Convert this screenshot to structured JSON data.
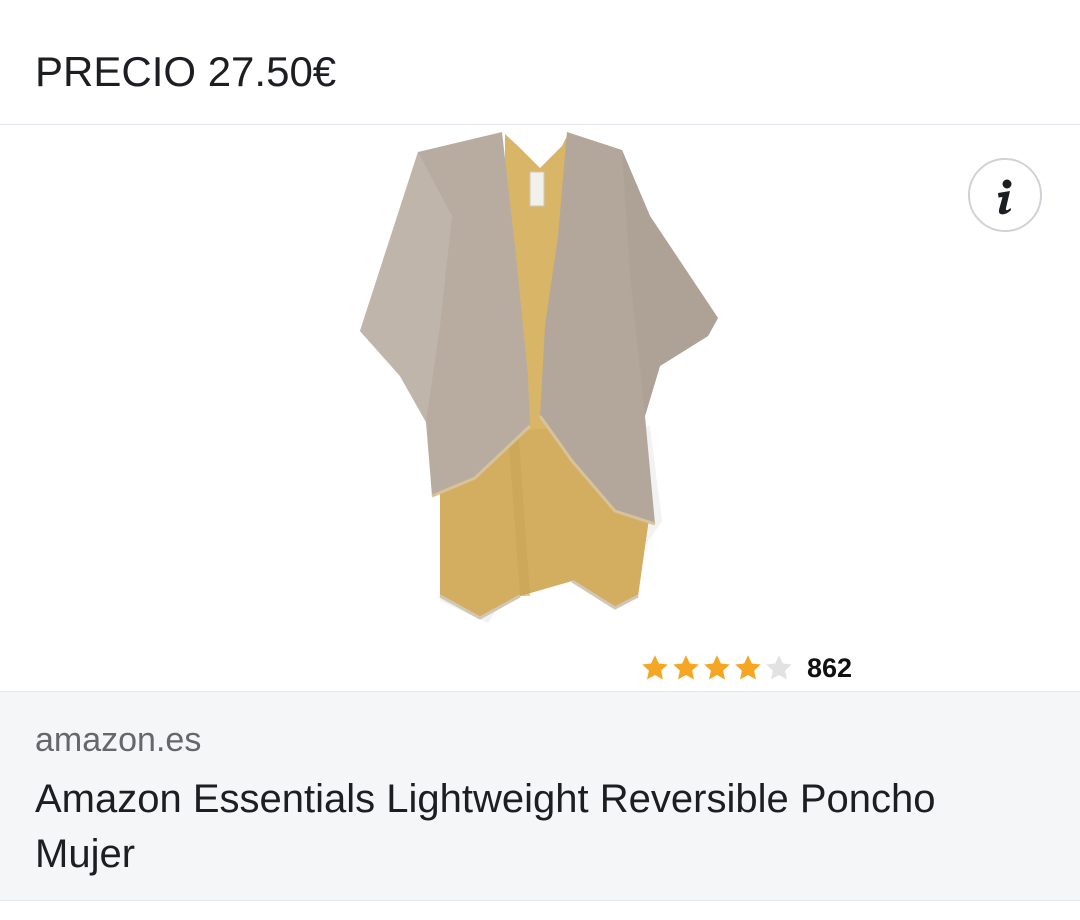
{
  "price_bar": {
    "text": "PRECIO 27.50€"
  },
  "product": {
    "image_icon": "poncho-product-image",
    "info_icon": "info-icon",
    "rating": {
      "stars": 4,
      "max_stars": 5,
      "count": "862"
    }
  },
  "footer": {
    "domain": "amazon.es",
    "title": "Amazon Essentials Lightweight Reversible Poncho Mujer"
  },
  "colors": {
    "star_filled": "#f5a623",
    "star_empty": "#e2e2e2",
    "poncho_outer": "#b8aca1",
    "poncho_inner": "#d9b567",
    "footer_bg": "#f5f6f7"
  }
}
